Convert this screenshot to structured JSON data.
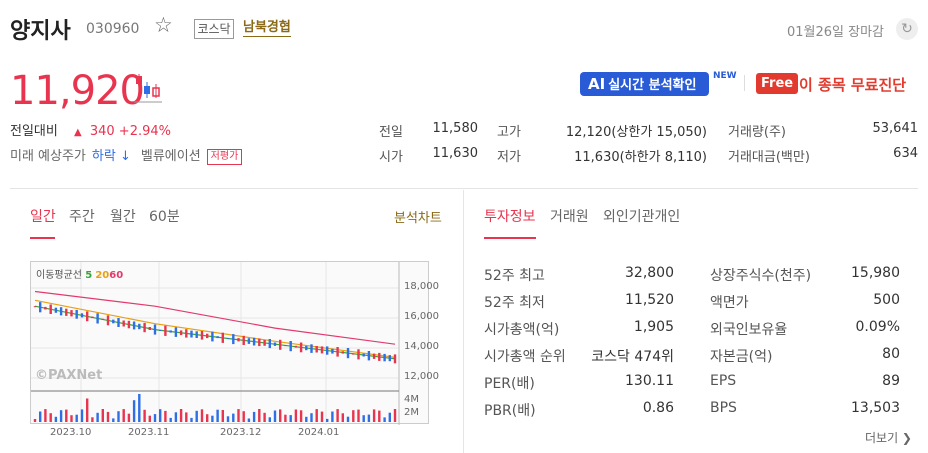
{
  "header": {
    "stock_name": "양지사",
    "stock_code": "030960",
    "market": "코스닥",
    "theme": "남북경협",
    "date_status": "01월26일 장마감"
  },
  "price": {
    "current": "11,920",
    "change_label": "전일대비",
    "change": "340",
    "change_pct": "+2.94%",
    "pred_label": "미래 예상주가",
    "pred_value": "하락 ↓",
    "valuation_label": "벨류에이션",
    "valuation_badge": "저평가"
  },
  "promo": {
    "ai_label": "AI",
    "ai_text": "실시간 분석확인",
    "new_tag": "NEW",
    "free_tag": "Free",
    "free_text": "이 종목 무료진단"
  },
  "quote": {
    "prev_close_label": "전일",
    "prev_close": "11,580",
    "open_label": "시가",
    "open": "11,630",
    "high_label": "고가",
    "high": "12,120(상한가 15,050)",
    "low_label": "저가",
    "low": "11,630(하한가 8,110)",
    "volume_label": "거래량(주)",
    "volume": "53,641",
    "amount_label": "거래대금(백만)",
    "amount": "634"
  },
  "chart_tabs": [
    "일간",
    "주간",
    "월간",
    "60분"
  ],
  "chart_link": "분석차트",
  "info_tabs": [
    "투자정보",
    "거래원",
    "외인기관개인"
  ],
  "chart": {
    "ma_label": "이동평균선",
    "ma_5": "5",
    "ma_20": "20",
    "ma_60": "60",
    "y_ticks": [
      "18,000",
      "16,000",
      "14,000",
      "12,000"
    ],
    "vol_ticks": [
      "4M",
      "2M"
    ],
    "x_ticks": [
      "2023.10",
      "2023.11",
      "2023.12",
      "2024.01"
    ],
    "watermark": "©PAXNet",
    "colors": {
      "ma5": "#38a538",
      "ma20": "#e8a010",
      "ma60": "#e23a6e",
      "up": "#e8344e",
      "down": "#2e6ee6"
    }
  },
  "chart_data": {
    "type": "line",
    "x": [
      "2023.10",
      "2023.11",
      "2023.12",
      "2024.01"
    ],
    "ylim": [
      11000,
      19000
    ],
    "series": [
      {
        "name": "5",
        "values": [
          16800,
          15200,
          14200,
          13200
        ]
      },
      {
        "name": "20",
        "values": [
          17200,
          15600,
          14400,
          13300
        ]
      },
      {
        "name": "60",
        "values": [
          17800,
          16800,
          15300,
          14200
        ]
      }
    ]
  },
  "info": {
    "left": [
      {
        "label": "52주 최고",
        "value": "32,800"
      },
      {
        "label": "52주 최저",
        "value": "11,520"
      },
      {
        "label": "시가총액(억)",
        "value": "1,905"
      },
      {
        "label": "시가총액 순위",
        "value": "코스닥 474위"
      },
      {
        "label": "PER(배)",
        "value": "130.11"
      },
      {
        "label": "PBR(배)",
        "value": "0.86"
      }
    ],
    "right": [
      {
        "label": "상장주식수(천주)",
        "value": "15,980"
      },
      {
        "label": "액면가",
        "value": "500"
      },
      {
        "label": "외국인보유율",
        "value": "0.09%"
      },
      {
        "label": "자본금(억)",
        "value": "80"
      },
      {
        "label": "EPS",
        "value": "89"
      },
      {
        "label": "BPS",
        "value": "13,503"
      }
    ],
    "more": "더보기 ❯"
  }
}
